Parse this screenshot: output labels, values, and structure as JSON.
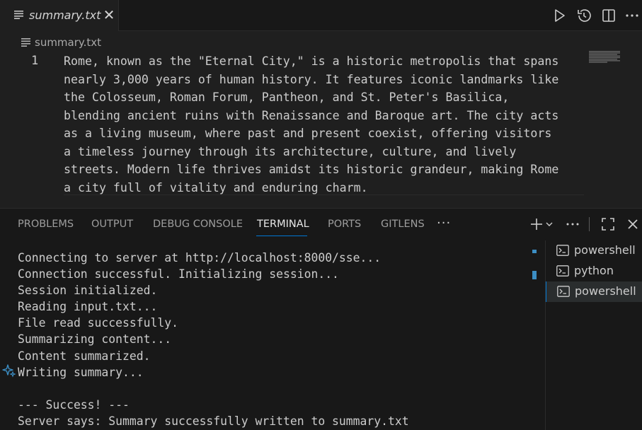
{
  "tab": {
    "label": "summary.txt",
    "close_glyph": "✕",
    "icon": "file-text-icon"
  },
  "toolbar": {
    "icons": [
      "run-icon",
      "timeline-history-icon",
      "split-editor-icon",
      "more-actions-icon"
    ]
  },
  "breadcrumb": {
    "label": "summary.txt",
    "icon": "file-text-icon"
  },
  "editor": {
    "line_number": "1",
    "text": "Rome, known as the \"Eternal City,\" is a historic metropolis that spans\nnearly 3,000 years of human history. It features iconic landmarks like\nthe Colosseum, Roman Forum, Pantheon, and St. Peter's Basilica,\nblending ancient ruins with Renaissance and Baroque art. The city acts\nas a living museum, where past and present coexist, offering visitors\na timeless journey through its architecture, culture, and lively\nstreets. Modern life thrives amidst its historic grandeur, making Rome\na city full of vitality and enduring charm."
  },
  "panel": {
    "tabs": [
      {
        "label": "PROBLEMS"
      },
      {
        "label": "OUTPUT"
      },
      {
        "label": "DEBUG CONSOLE"
      },
      {
        "label": "TERMINAL"
      },
      {
        "label": "PORTS"
      },
      {
        "label": "GITLENS"
      }
    ],
    "active_tab": "TERMINAL",
    "more_label": "···"
  },
  "terminal": {
    "lines": [
      "Connecting to server at http://localhost:8000/sse...",
      "Connection successful. Initializing session...",
      "Session initialized.",
      "Reading input.txt...",
      "File read successfully.",
      "Summarizing content...",
      "Content summarized.",
      "Writing summary...",
      "",
      "--- Success! ---",
      "Server says: Summary successfully written to summary.txt"
    ]
  },
  "terminal_list": [
    {
      "label": "powershell",
      "active": false
    },
    {
      "label": "python",
      "active": false
    },
    {
      "label": "powershell",
      "active": true
    }
  ],
  "colors": {
    "accent": "#0078d4",
    "background": "#1f1f1f",
    "panel": "#181818",
    "text": "#cccccc"
  }
}
